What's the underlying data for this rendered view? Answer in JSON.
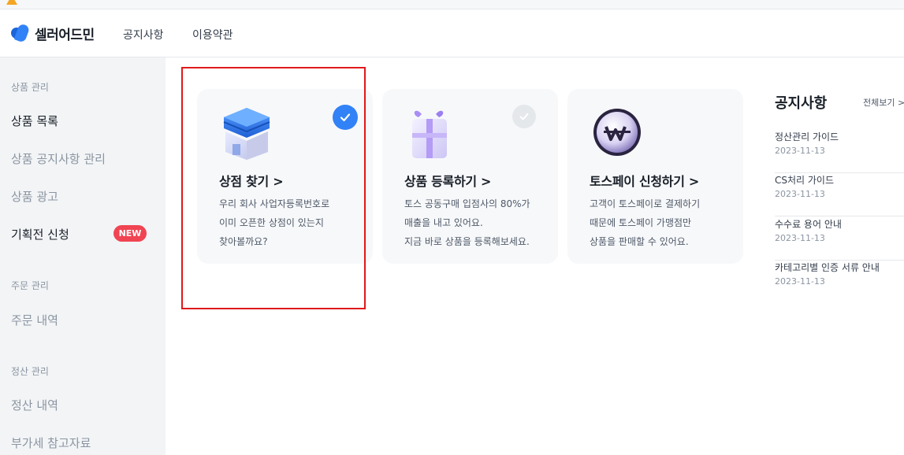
{
  "header": {
    "logo": "셀러어드민",
    "nav": [
      "공지사항",
      "이용약관"
    ]
  },
  "sidebar": {
    "sections": [
      {
        "title": "상품 관리",
        "items": [
          "상품 목록",
          "상품 공지사항 관리",
          "상품 광고",
          "기획전 신청"
        ]
      },
      {
        "title": "주문 관리",
        "items": [
          "주문 내역"
        ]
      },
      {
        "title": "정산 관리",
        "items": [
          "정산 내역",
          "부가세 참고자료"
        ]
      }
    ],
    "badge": "NEW"
  },
  "cards": [
    {
      "title": "상점 찾기 >",
      "desc": [
        "우리 회사 사업자등록번호로",
        "이미 오픈한 상점이 있는지",
        "찾아볼까요?"
      ],
      "checked": true
    },
    {
      "title": "상품 등록하기 >",
      "desc": [
        "토스 공동구매 입점사의 80%가",
        "매출을 내고 있어요.",
        "지금 바로 상품을 등록해보세요."
      ],
      "checked": false
    },
    {
      "title": "토스페이 신청하기 >",
      "desc": [
        "고객이 토스페이로 결제하기",
        "때문에 토스페이 가맹점만",
        "상품을 판매할 수 있어요."
      ],
      "checked": false
    }
  ],
  "notices": {
    "title": "공지사항",
    "view_all": "전체보기 >",
    "items": [
      {
        "title": "정산관리 가이드",
        "date": "2023-11-13"
      },
      {
        "title": "CS처리 가이드",
        "date": "2023-11-13"
      },
      {
        "title": "수수료 용어 안내",
        "date": "2023-11-13"
      },
      {
        "title": "카테고리별 인증 서류 안내",
        "date": "2023-11-13"
      }
    ]
  },
  "colors": {
    "accent": "#3182f6",
    "badge": "#f04452",
    "highlight": "#e0191a"
  }
}
